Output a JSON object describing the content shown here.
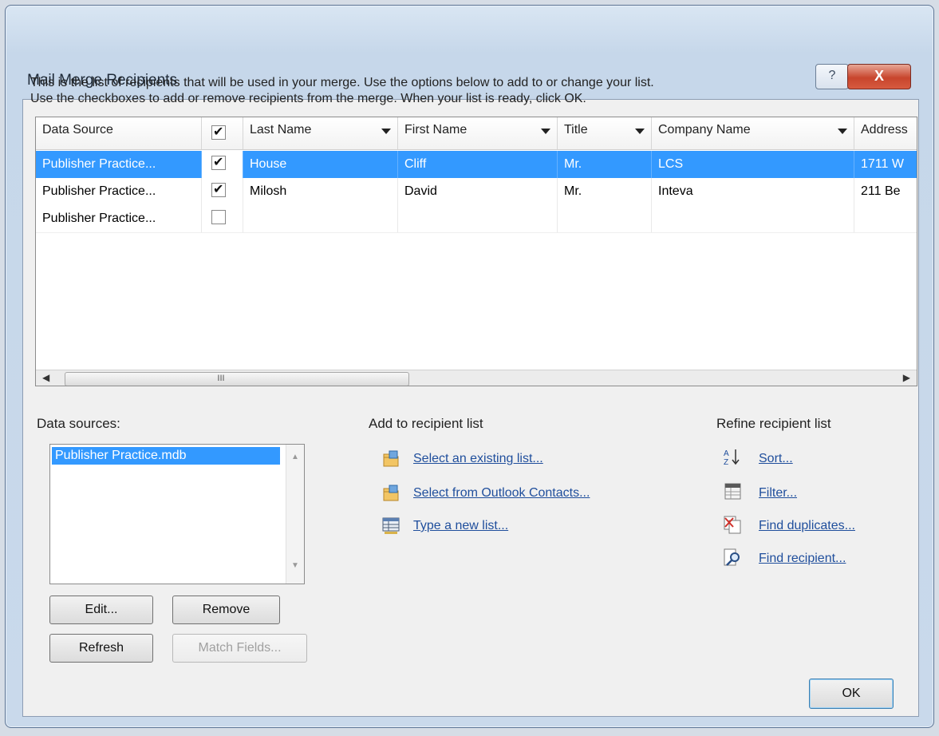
{
  "window": {
    "title": "Mail Merge Recipients",
    "help_glyph": "?",
    "close_glyph": "X"
  },
  "intro": {
    "line1": "This is the list of recipients that will be used in your merge.  Use the options below to add to or change your list.",
    "line2": "Use the checkboxes to add or remove recipients from the merge.  When your list is ready, click OK."
  },
  "grid": {
    "columns": [
      "Data Source",
      "",
      "Last Name",
      "First Name",
      "Title",
      "Company Name",
      "Address"
    ],
    "header_checked": true,
    "rows": [
      {
        "source": "Publisher Practice...",
        "checked": true,
        "last": "House",
        "first": "Cliff",
        "title": "Mr.",
        "company": "LCS",
        "address": "1711 W",
        "selected": true
      },
      {
        "source": "Publisher Practice...",
        "checked": true,
        "last": "Milosh",
        "first": "David",
        "title": "Mr.",
        "company": "Inteva",
        "address": "211 Be",
        "selected": false
      },
      {
        "source": "Publisher Practice...",
        "checked": false,
        "last": "",
        "first": "",
        "title": "",
        "company": "",
        "address": "",
        "selected": false
      }
    ],
    "scroll_grip": "III"
  },
  "data_sources": {
    "label": "Data sources:",
    "items": [
      "Publisher Practice.mdb"
    ],
    "edit": "Edit...",
    "remove": "Remove",
    "refresh": "Refresh",
    "match_fields": "Match Fields..."
  },
  "add_section": {
    "label": "Add to recipient list",
    "select_existing": "Select an existing list...",
    "select_outlook": "Select from Outlook Contacts...",
    "type_new": "Type a new list..."
  },
  "refine_section": {
    "label": "Refine recipient list",
    "sort": "Sort...",
    "filter": "Filter...",
    "find_duplicates": "Find duplicates...",
    "find_recipient": "Find recipient..."
  },
  "ok": "OK",
  "colors": {
    "selection": "#3399ff",
    "link": "#1f4e9c",
    "close": "#c8452d"
  }
}
